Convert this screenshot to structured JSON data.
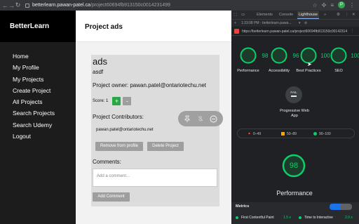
{
  "browser": {
    "url_host": "betterlearn.pawan-patel.ca",
    "url_path": "/project60694fb913150c0014231499",
    "avatar_letter": "P"
  },
  "sidebar": {
    "brand": "BetterLearn",
    "items": [
      "Home",
      "My Profile",
      "My Projects",
      "Create Project",
      "All Projects",
      "Search Projects",
      "Search Udemy",
      "Logout"
    ]
  },
  "main": {
    "title": "Project ads",
    "project_name": "ads",
    "description": "asdf",
    "owner_text": "Project owner: pawan.patel@ontariotechu.net",
    "score_label": "Score: 1",
    "plus_label": "+",
    "minus_label": "-",
    "contributors_title": "Project Contributors:",
    "contributors": [
      "pawan.patel@ontariotechu.net"
    ],
    "remove_label": "Remove from profile",
    "delete_label": "Delete Project",
    "comments_label": "Comments:",
    "comment_placeholder": "Add a comment...",
    "add_comment_label": "Add Comment"
  },
  "devtools": {
    "tabs": [
      "Elements",
      "Console",
      "Lighthouse",
      "»"
    ],
    "active_tab": "Lighthouse",
    "report_selector": "1:33:08 PM - betterlearn.pawa...",
    "report_url": "https://betterlearn.pawan-patel.ca/project60694fb913150c0014231499",
    "scores": [
      {
        "label": "Performance",
        "value": "98"
      },
      {
        "label": "Accessibility",
        "value": "96"
      },
      {
        "label": "Best Practices",
        "value": "100"
      },
      {
        "label": "SEO",
        "value": "100"
      }
    ],
    "pwa": {
      "badge": "FAIL",
      "label": "Progressive Web App"
    },
    "legend": [
      "0–49",
      "50–89",
      "90–100"
    ],
    "performance_score": "98",
    "performance_label": "Performance",
    "metrics_title": "Metrics",
    "metrics": [
      {
        "name": "First Contentful Paint",
        "value": "1.5 s"
      },
      {
        "name": "Time to Interactive",
        "value": "2.0 s"
      }
    ],
    "colors": {
      "pass": "#0cce6b",
      "average": "#ffa400",
      "fail": "#ff4e42"
    }
  }
}
